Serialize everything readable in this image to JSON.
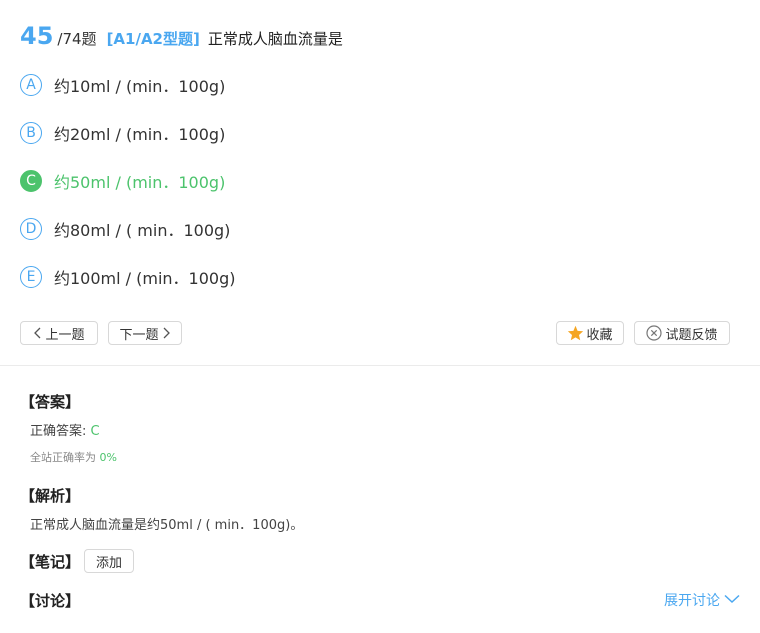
{
  "question": {
    "number": "45",
    "total": "/74题",
    "type": "[A1/A2型题]",
    "stem": "正常成人脑血流量是"
  },
  "options": [
    {
      "letter": "A",
      "text": "约10ml / (min．100g)"
    },
    {
      "letter": "B",
      "text": "约20ml / (min．100g)"
    },
    {
      "letter": "C",
      "text": "约50ml / (min．100g)"
    },
    {
      "letter": "D",
      "text": "约80ml / ( min．100g)"
    },
    {
      "letter": "E",
      "text": "约100ml / (min．100g)"
    }
  ],
  "selected_option": "C",
  "nav": {
    "prev_label": "上一题",
    "next_label": "下一题",
    "favorite_label": "收藏",
    "feedback_label": "试题反馈"
  },
  "answer": {
    "title": "【答案】",
    "correct_label": "正确答案: ",
    "correct_value": "C",
    "rate_label": "全站正确率为 ",
    "rate_value": "0%"
  },
  "analysis": {
    "title": "【解析】",
    "text": "正常成人脑血流量是约50ml / ( min．100g)。"
  },
  "notes": {
    "title": "【笔记】",
    "add_label": "添加"
  },
  "discussion": {
    "title": "【讨论】",
    "expand_label": "展开讨论"
  },
  "colors": {
    "accent": "#4aa7f0",
    "correct": "#4cc36c",
    "star": "#f5a623"
  },
  "icons": [
    "chevron-left-icon",
    "chevron-right-icon",
    "star-icon",
    "close-circle-icon",
    "chevron-down-icon"
  ]
}
